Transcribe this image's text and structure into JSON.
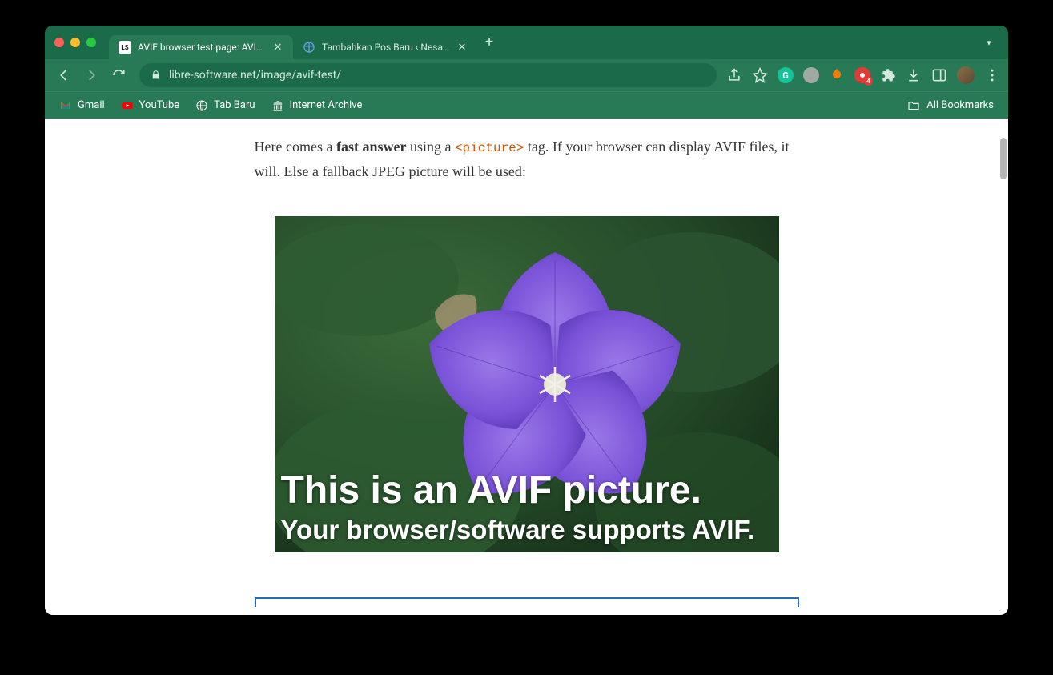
{
  "tabs": [
    {
      "title": "AVIF browser test page: AVIF s",
      "favicon": "LS"
    },
    {
      "title": "Tambahkan Pos Baru ‹ Nesaba"
    }
  ],
  "url": "libre-software.net/image/avif-test/",
  "bookmarks": [
    {
      "label": "Gmail"
    },
    {
      "label": "YouTube"
    },
    {
      "label": "Tab Baru"
    },
    {
      "label": "Internet Archive"
    }
  ],
  "all_bookmarks_label": "All Bookmarks",
  "extension_badge": "4",
  "article": {
    "para_before": "Here comes a ",
    "para_bold": "fast answer",
    "para_mid": " using a ",
    "code": "<picture>",
    "para_after": " tag. If your browser can display AVIF files, it will. Else a fallback JPEG picture will be used:",
    "overlay_line1": "This is an AVIF picture.",
    "overlay_line2": "Your browser/software supports AVIF."
  }
}
